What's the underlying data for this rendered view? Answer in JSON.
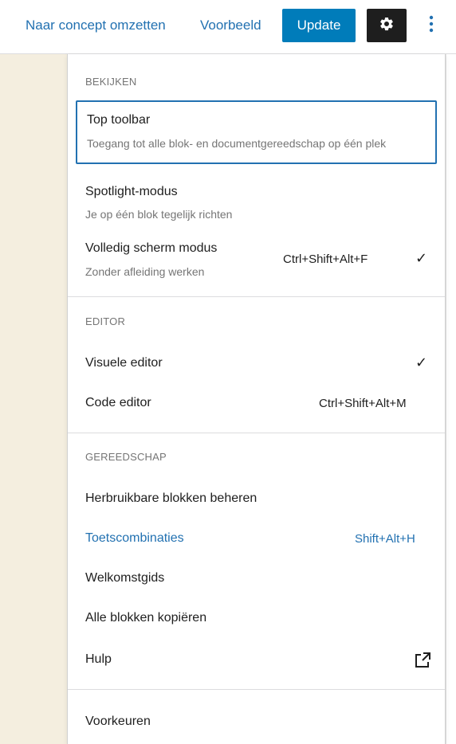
{
  "header": {
    "switch_to_draft": "Naar concept omzetten",
    "preview": "Voorbeeld",
    "update": "Update",
    "settings_icon": "gear-icon",
    "more_icon": "vertical-ellipsis-icon"
  },
  "colors": {
    "accent": "#2271b1",
    "primary_button": "#007cba",
    "canvas": "#f4eedf",
    "dark_button": "#1e1e1e"
  },
  "menu": {
    "view": {
      "label": "BEKIJKEN",
      "items": [
        {
          "title": "Top toolbar",
          "description": "Toegang tot alle blok- en documentgereedschap op één plek"
        },
        {
          "title": "Spotlight-modus",
          "description": "Je op één blok tegelijk richten"
        },
        {
          "title": "Volledig scherm modus",
          "description": "Zonder afleiding werken",
          "shortcut": "Ctrl+Shift+Alt+F",
          "checked": "✓"
        }
      ]
    },
    "editor": {
      "label": "EDITOR",
      "items": [
        {
          "title": "Visuele editor",
          "checked": "✓"
        },
        {
          "title": "Code editor",
          "shortcut": "Ctrl+Shift+Alt+M"
        }
      ]
    },
    "tools": {
      "label": "GEREEDSCHAP",
      "items": [
        {
          "title": "Herbruikbare blokken beheren"
        },
        {
          "title": "Toetscombinaties",
          "shortcut": "Shift+Alt+H"
        },
        {
          "title": "Welkomstgids"
        },
        {
          "title": "Alle blokken kopiëren"
        },
        {
          "title": "Hulp",
          "icon": "external-link-icon"
        }
      ]
    },
    "preferences": {
      "title": "Voorkeuren"
    }
  }
}
